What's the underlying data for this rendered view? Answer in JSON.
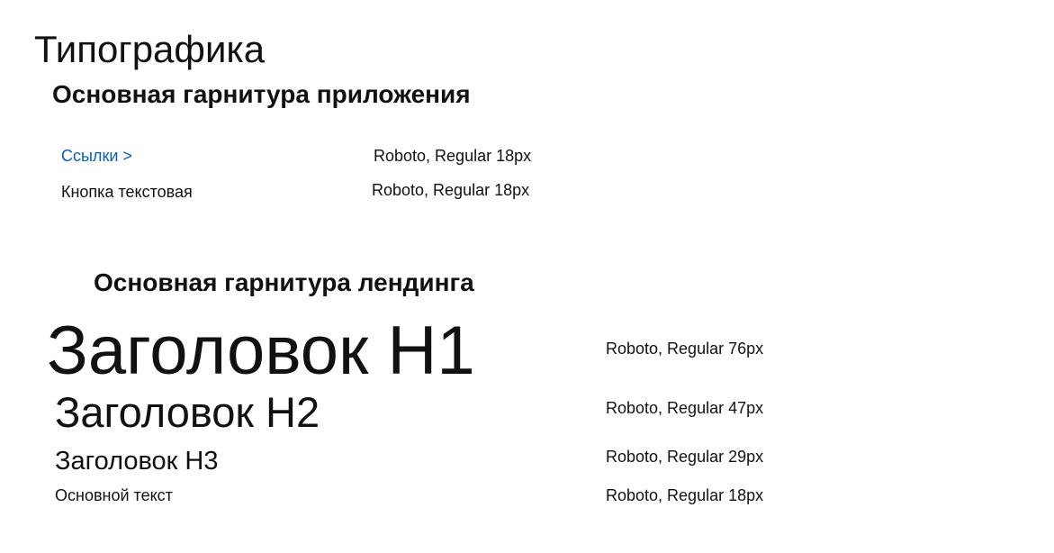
{
  "page_title": "Типографика",
  "app_section": {
    "title": "Основная гарнитура приложения",
    "rows": [
      {
        "sample": "Ссылки >",
        "spec": "Roboto, Regular 18px"
      },
      {
        "sample": "Кнопка текстовая",
        "spec": "Roboto, Regular 18px"
      }
    ]
  },
  "landing_section": {
    "title": "Основная гарнитура лендинга",
    "rows": [
      {
        "sample": "Заголовок H1",
        "spec": "Roboto, Regular 76px"
      },
      {
        "sample": "Заголовок H2",
        "spec": "Roboto, Regular 47px"
      },
      {
        "sample": "Заголовок H3",
        "spec": "Roboto, Regular 29px"
      },
      {
        "sample": "Основной текст",
        "spec": "Roboto, Regular 18px"
      }
    ]
  },
  "colors": {
    "link": "#0b5fb3",
    "text": "#111111",
    "background": "#ffffff"
  }
}
